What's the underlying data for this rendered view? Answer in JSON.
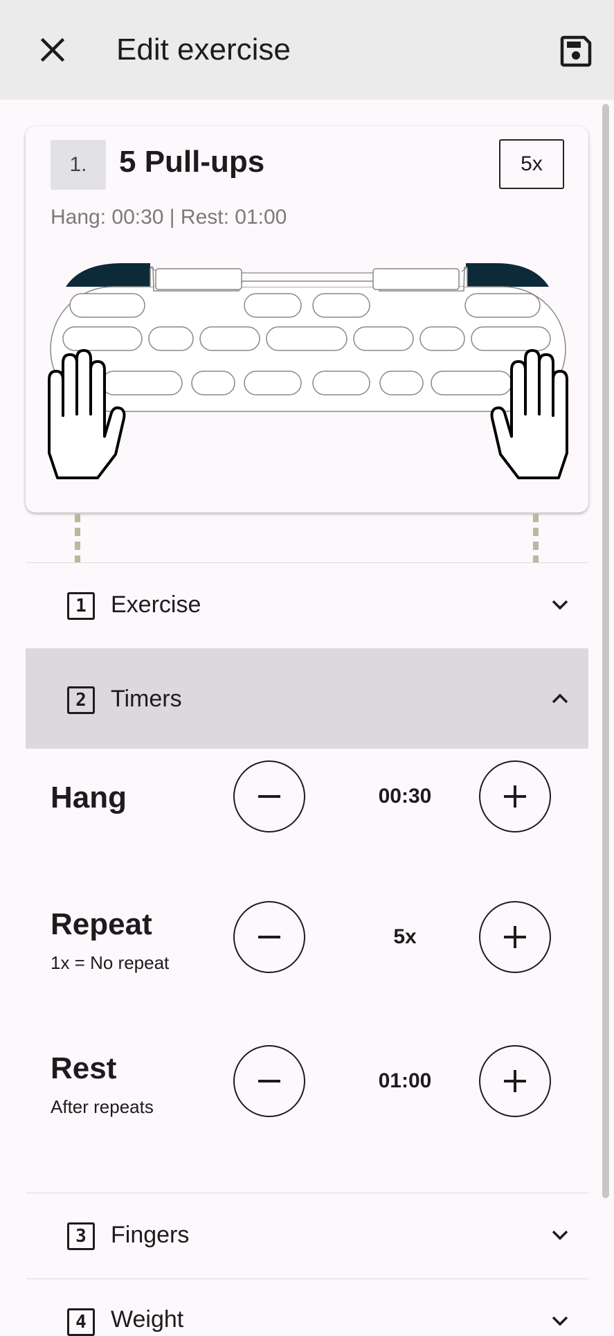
{
  "toolbar": {
    "title": "Edit exercise",
    "close_icon": "close-icon",
    "save_icon": "save-icon"
  },
  "card": {
    "number": "1.",
    "title": "5  Pull-ups",
    "repeat_badge": "5x",
    "subtitle": "Hang: 00:30 | Rest: 01:00",
    "accent_color": "#0d2a38"
  },
  "sections": [
    {
      "num": "1",
      "label": "Exercise",
      "expanded": false
    },
    {
      "num": "2",
      "label": "Timers",
      "expanded": true
    },
    {
      "num": "3",
      "label": "Fingers",
      "expanded": false
    },
    {
      "num": "4",
      "label": "Weight",
      "expanded": false
    }
  ],
  "timers": {
    "hang": {
      "label": "Hang",
      "sub": "",
      "value": "00:30"
    },
    "repeat": {
      "label": "Repeat",
      "sub": "1x = No repeat",
      "value": "5x"
    },
    "rest": {
      "label": "Rest",
      "sub": "After repeats",
      "value": "01:00"
    }
  },
  "colors": {
    "toolbar_bg": "#ebebeb",
    "active_section_bg": "#dcd8db",
    "connector": "#b4bb9e"
  }
}
